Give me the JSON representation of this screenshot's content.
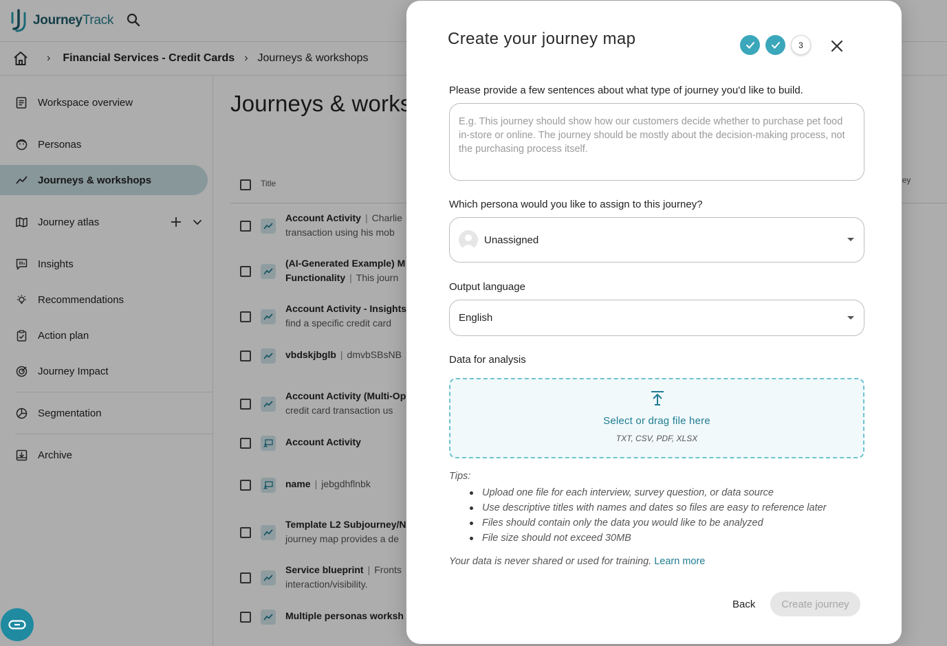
{
  "app": {
    "logo_bold": "Journey",
    "logo_light": "Track",
    "search_icon": "search-icon"
  },
  "breadcrumbs": {
    "home_icon": "home-icon",
    "workspace": "Financial Services - Credit Cards",
    "current": "Journeys & workshops"
  },
  "sidebar": {
    "items": [
      {
        "label": "Workspace overview",
        "icon": "document-icon"
      },
      {
        "label": "Personas",
        "icon": "persona-icon"
      },
      {
        "label": "Journeys & workshops",
        "icon": "trend-icon",
        "active": true
      },
      {
        "label": "Journey atlas",
        "icon": "map-icon"
      },
      {
        "label": "Insights",
        "icon": "insights-icon"
      },
      {
        "label": "Recommendations",
        "icon": "lightbulb-icon"
      },
      {
        "label": "Action plan",
        "icon": "clipboard-icon"
      },
      {
        "label": "Journey Impact",
        "icon": "target-icon"
      },
      {
        "label": "Segmentation",
        "icon": "pie-icon"
      },
      {
        "label": "Archive",
        "icon": "archive-icon"
      }
    ]
  },
  "main": {
    "page_title": "Journeys & workshops",
    "table": {
      "col_title": "Title",
      "col_journey": "rney",
      "col_journey2": "s",
      "rows": [
        {
          "title": "Account Activity",
          "desc": "Charlie",
          "line2": "transaction using his mob"
        },
        {
          "title": "(AI-Generated Example) M",
          "desc": "",
          "line2_bold": "Functionality",
          "line2": "This journ"
        },
        {
          "title": "Account Activity - Insights",
          "desc": "",
          "line2": "find a specific credit card"
        },
        {
          "title": "vbdskjbglb",
          "desc": "dmvbSBsNB",
          "line2": ""
        },
        {
          "title": "Account Activity (Multi-Op",
          "desc": "",
          "line2": "credit card transaction us"
        },
        {
          "title": "Account Activity",
          "desc": "",
          "line2": ""
        },
        {
          "title": "name",
          "desc": "jebgdhflnbk",
          "line2": ""
        },
        {
          "title": "Template L2 Subjourney/N",
          "desc": "",
          "line2": "journey map provides a de"
        },
        {
          "title": "Service blueprint",
          "desc": "Fronts",
          "line2": "interaction/visibility."
        },
        {
          "title": "Multiple personas worksh",
          "desc": "",
          "line2": ""
        }
      ]
    }
  },
  "modal": {
    "title": "Create your journey map",
    "steps": [
      {
        "state": "done",
        "icon": "check-icon"
      },
      {
        "state": "done",
        "icon": "check-icon"
      },
      {
        "state": "current",
        "label": "3"
      }
    ],
    "close_icon": "close-icon",
    "description_label": "Please provide a few sentences about what type of journey you'd like to build.",
    "description_placeholder": "E.g. This journey should show how our customers decide whether to purchase pet food in-store or online. The journey should be mostly about the decision-making process, not the purchasing process itself.",
    "persona_label": "Which persona would you like to assign to this journey?",
    "persona_value": "Unassigned",
    "language_label": "Output language",
    "language_value": "English",
    "data_label": "Data for analysis",
    "dropzone_text": "Select or drag file here",
    "dropzone_formats": "TXT, CSV, PDF, XLSX",
    "tips_title": "Tips:",
    "tips": [
      "Upload one file for each interview, survey question, or data source",
      "Use descriptive titles with names and dates so files are easy to reference later",
      "Files should contain only the data you would like to be analyzed",
      "File size should not exceed 30MB"
    ],
    "privacy_text": "Your data is never shared or used for training.",
    "learn_more": "Learn more",
    "back_label": "Back",
    "create_label": "Create journey"
  },
  "colors": {
    "accent": "#3ba7bb",
    "link": "#1f7c91",
    "active_nav": "#c9dfe4"
  }
}
